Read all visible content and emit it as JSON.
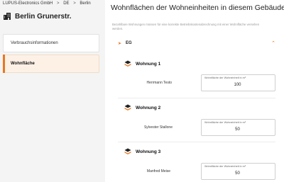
{
  "breadcrumb": [
    "LUPUS-Electronics GmbH",
    "DE",
    "Berlin"
  ],
  "breadcrumb_separator": ">",
  "building": {
    "name": "Berlin Grunerstr.",
    "icon": "building-icon"
  },
  "sidebar": {
    "items": [
      {
        "label": "Verbrauchsinformationen",
        "active": false
      },
      {
        "label": "Wohnfläche",
        "active": true
      }
    ]
  },
  "main": {
    "title": "Wohnflächen der Wohneinheiten in diesem Gebäude",
    "hint": "Bezahlbare Wohnungen müssen für eine korrekte Betriebskostenabrechnung mit einer Wohnfläche versehen werden.",
    "floor": {
      "label": "EG",
      "expanded": true
    },
    "units": [
      {
        "title": "Wohnung 1",
        "tenant": "Herrmann Testo",
        "field_label": "Wohnfläche der Wohneinheit in m²",
        "value": "100"
      },
      {
        "title": "Wohnung 2",
        "tenant": "Sylvester Stallone",
        "field_label": "Wohnfläche der Wohneinheit in m²",
        "value": "50"
      },
      {
        "title": "Wohnung 3",
        "tenant": "Manfred Meise",
        "field_label": "Wohnfläche der Wohneinheit in m²",
        "value": "50"
      }
    ]
  },
  "colors": {
    "accent": "#e87722",
    "sidebar_bg": "#f4f4f4",
    "active_bg": "#fdf1e6"
  }
}
